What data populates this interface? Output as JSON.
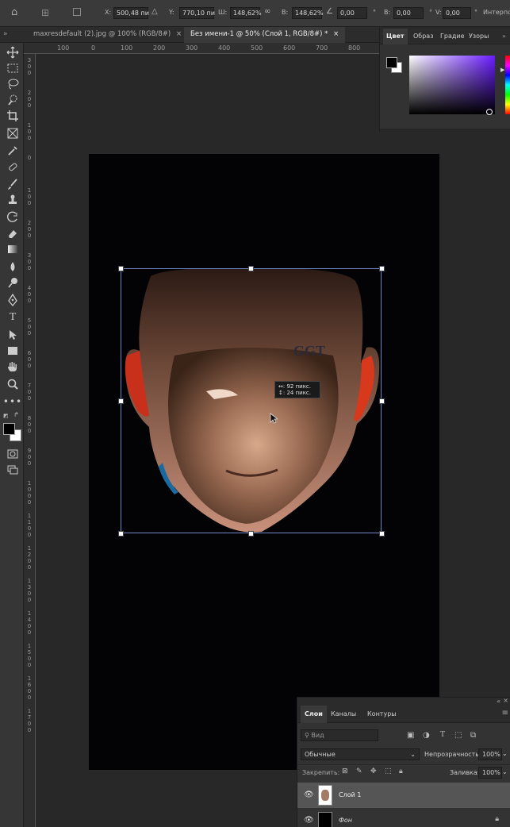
{
  "options_bar": {
    "x_label": "X:",
    "x_value": "500,48 пи",
    "y_label": "Y:",
    "y_value": "770,10 пи",
    "w_label": "Ш:",
    "w_value": "148,62%",
    "h_label": "В:",
    "h_value": "148,62%",
    "angle_value": "0,00",
    "h_skew_label": "В:",
    "h_skew_value": "0,00",
    "v_skew_label": "V:",
    "v_skew_value": "0,00",
    "interp_label": "Интерпо"
  },
  "tabs": [
    {
      "label": "maxresdefault (2).jpg @ 100% (RGB/8#)",
      "active": false
    },
    {
      "label": "Без имени-1 @ 50% (Слой 1, RGB/8#) *",
      "active": true
    }
  ],
  "ruler": {
    "h_ticks": [
      "100",
      "0",
      "100",
      "200",
      "300",
      "400",
      "500",
      "600",
      "700",
      "800"
    ],
    "v_ticks": [
      "300",
      "200",
      "100",
      "0",
      "100",
      "200",
      "300",
      "400",
      "500",
      "600",
      "700",
      "800",
      "900",
      "1000",
      "1100",
      "1200",
      "1300",
      "1400",
      "1500",
      "1600",
      "1700"
    ]
  },
  "transform_tooltip": {
    "line1": "↔: 92 пикс.",
    "line2": "↕: 24 пикс."
  },
  "color_panel": {
    "tabs": [
      "Цвет",
      "Образ",
      "Градие",
      "Узоры"
    ],
    "active_tab": "Цвет",
    "hue_color": "#6a1cff",
    "foreground": "#000000",
    "background": "#ffffff"
  },
  "layers_panel": {
    "tabs": [
      "Слои",
      "Каналы",
      "Контуры"
    ],
    "active_tab": "Слои",
    "search_placeholder": "Вид",
    "blend_mode": "Обычные",
    "opacity_label": "Непрозрачность:",
    "opacity_value": "100%",
    "lock_label": "Закрепить:",
    "fill_label": "Заливка:",
    "fill_value": "100%",
    "layers": [
      {
        "name": "Слой 1",
        "selected": true
      },
      {
        "name": "Фон",
        "selected": false
      }
    ]
  },
  "colors": {
    "canvas": "#030306",
    "selection_border": "#6f86c8",
    "panel_bg": "#333333"
  }
}
